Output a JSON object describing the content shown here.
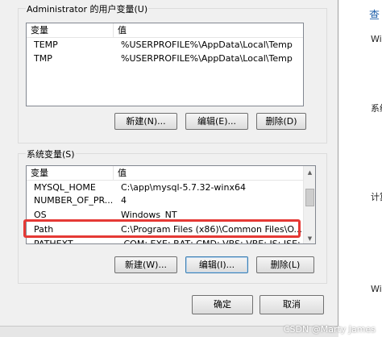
{
  "user_vars": {
    "group_title": "Administrator 的用户变量(U)",
    "col_name": "变量",
    "col_value": "值",
    "rows": [
      {
        "name": "TEMP",
        "value": "%USERPROFILE%\\AppData\\Local\\Temp"
      },
      {
        "name": "TMP",
        "value": "%USERPROFILE%\\AppData\\Local\\Temp"
      }
    ],
    "new_label": "新建(N)...",
    "edit_label": "编辑(E)...",
    "delete_label": "删除(D)"
  },
  "system_vars": {
    "group_title": "系统变量(S)",
    "col_name": "变量",
    "col_value": "值",
    "rows": [
      {
        "name": "MYSQL_HOME",
        "value": "C:\\app\\mysql-5.7.32-winx64"
      },
      {
        "name": "NUMBER_OF_PR...",
        "value": "4"
      },
      {
        "name": "OS",
        "value": "Windows_NT"
      },
      {
        "name": "Path",
        "value": "C:\\Program Files (x86)\\Common Files\\O..."
      },
      {
        "name": "PATHEXT",
        "value": ".COM;.EXE;.BAT;.CMD;.VBS;.VBE;.JS;.JSE;..."
      }
    ],
    "new_label": "新建(W)...",
    "edit_label": "编辑(I)...",
    "delete_label": "删除(L)"
  },
  "dialog": {
    "ok_label": "确定",
    "cancel_label": "取消"
  },
  "side": {
    "link": "查",
    "t1": "Wi",
    "t2": "系统",
    "t3": "计算",
    "t4": "Wi"
  },
  "watermark": "CSDN @Marty James",
  "colors": {
    "highlight": "#e53935",
    "dialog_bg": "#f0f0f0"
  }
}
